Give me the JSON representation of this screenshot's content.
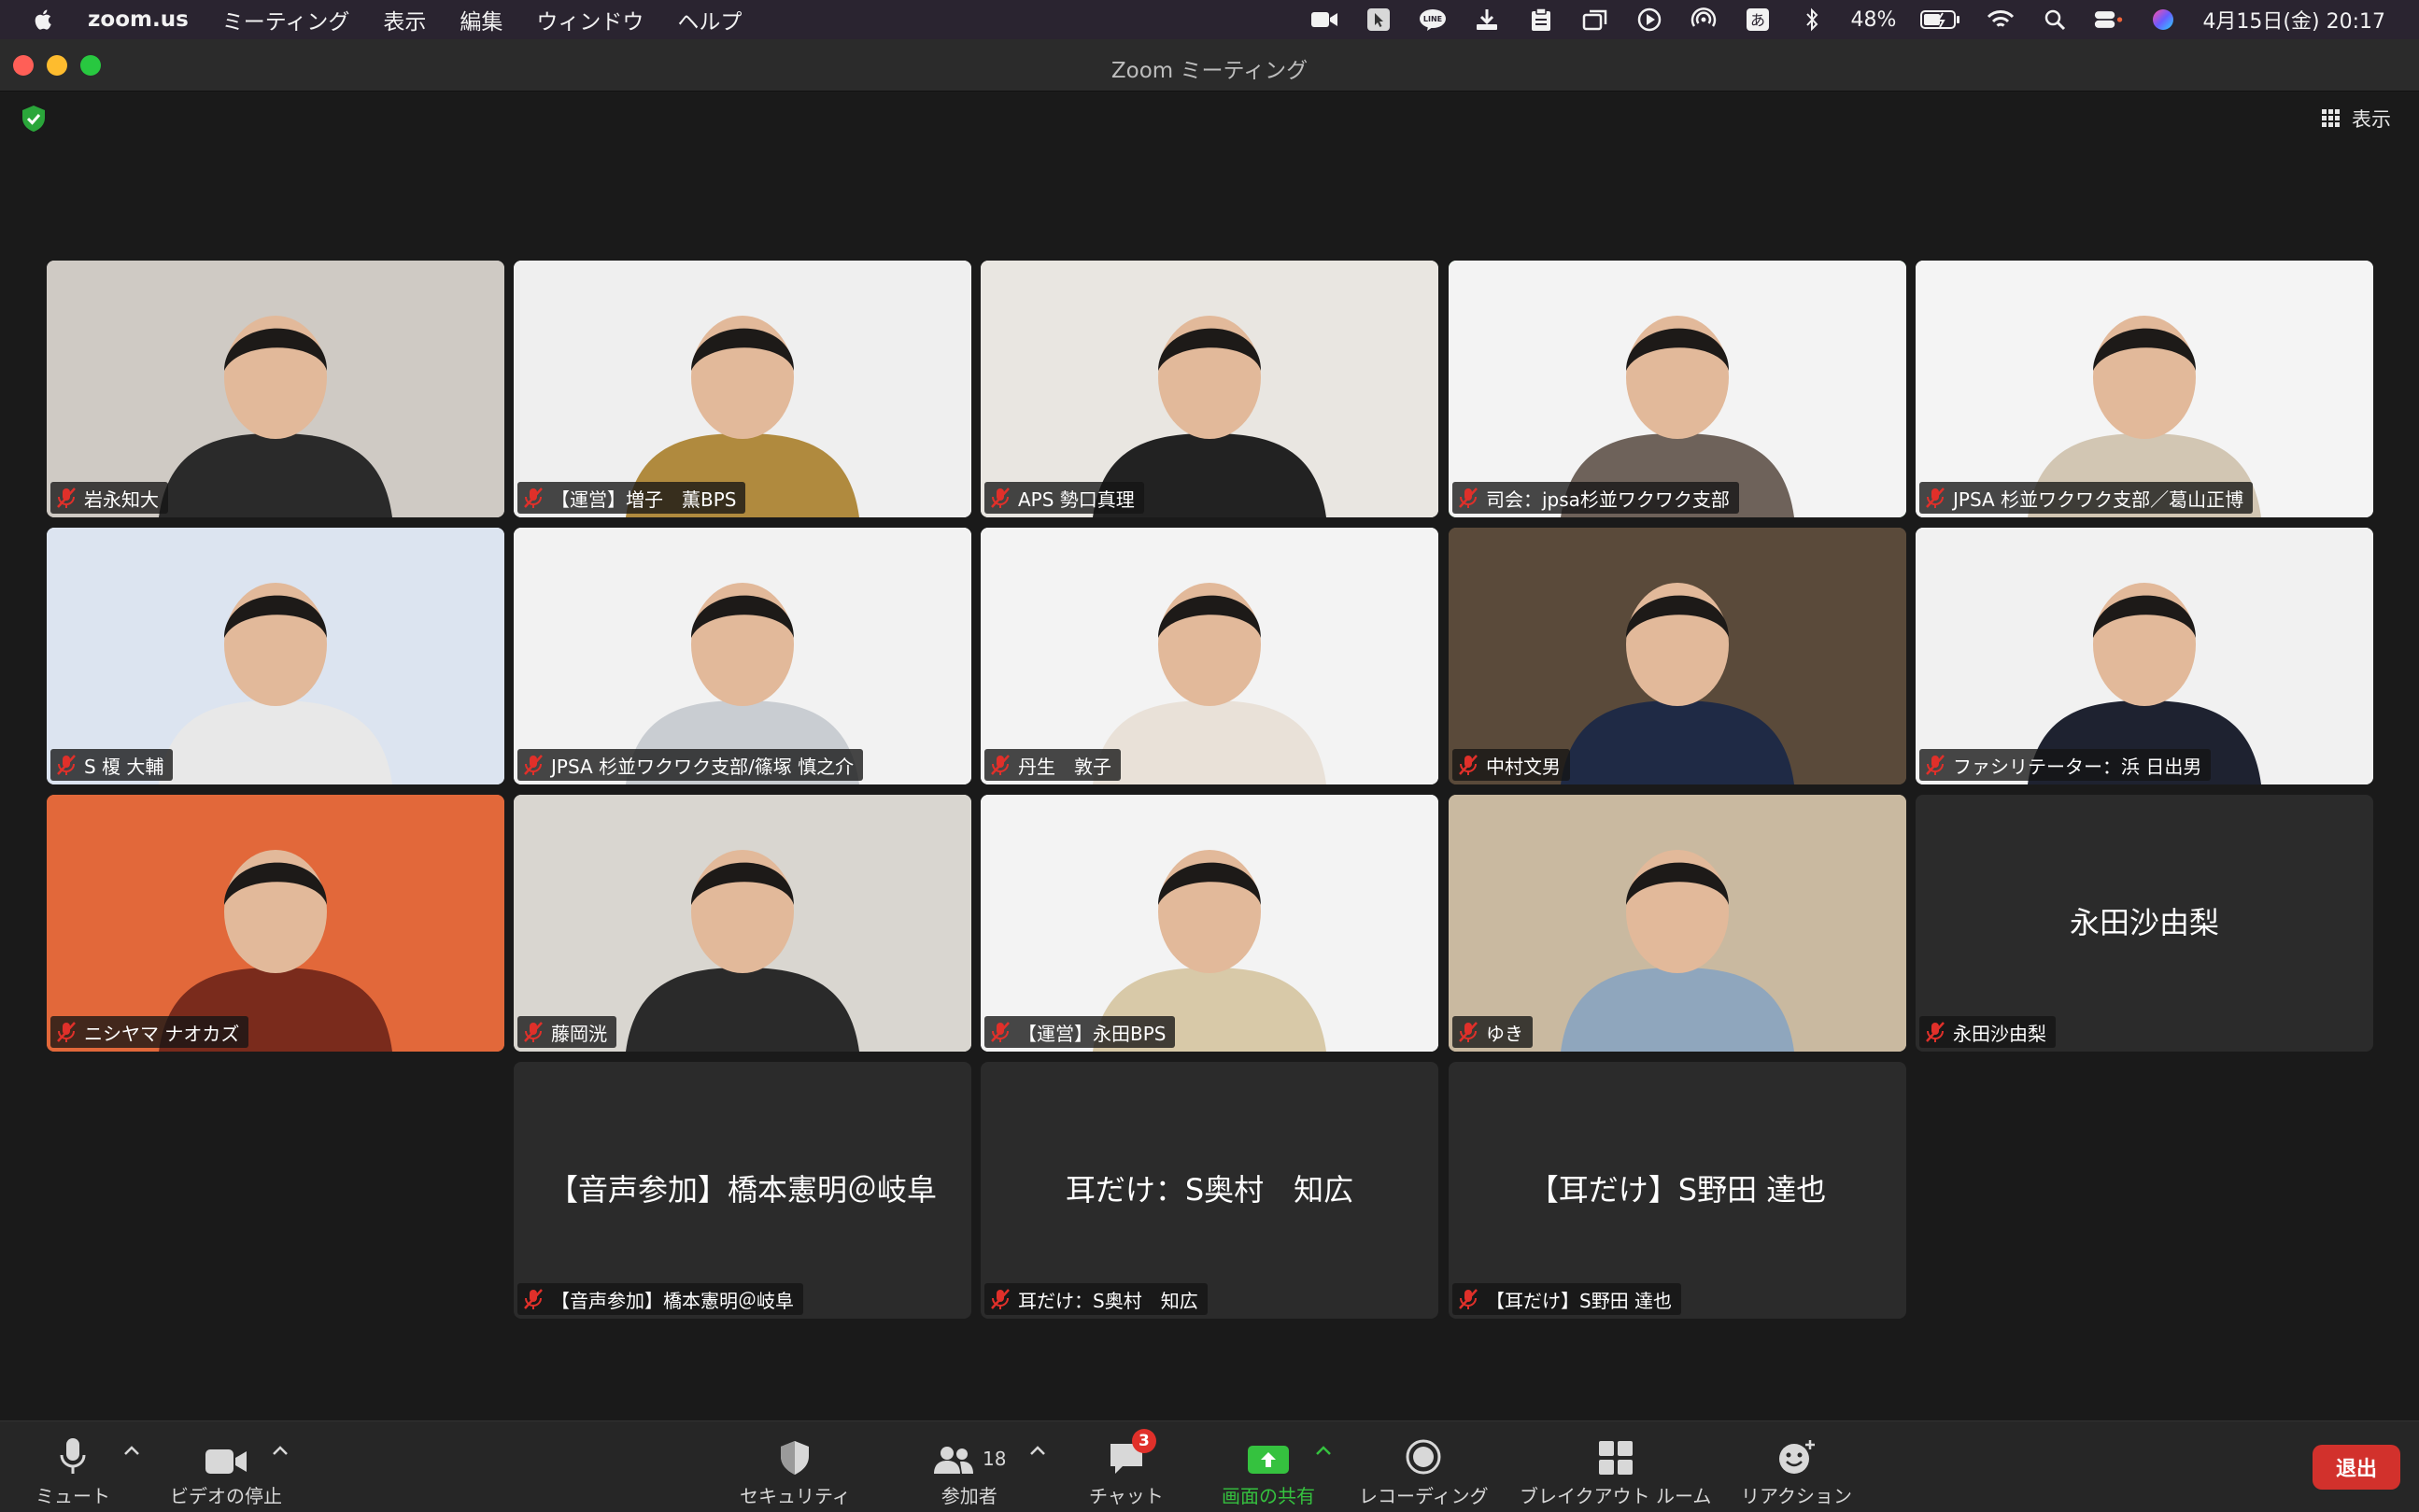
{
  "menubar": {
    "app_name": "zoom.us",
    "items": [
      "ミーティング",
      "表示",
      "編集",
      "ウィンドウ",
      "ヘルプ"
    ],
    "battery": "48%",
    "ime": "あ",
    "datetime": "4月15日(金) 20:17"
  },
  "window": {
    "title": "Zoom ミーティング"
  },
  "meeting": {
    "view_label": "表示"
  },
  "participants": [
    {
      "name": "岩永知大",
      "video": true,
      "bg": "#cfcac4",
      "shirt": "#2a2a2a"
    },
    {
      "name": "【運営】増子　薫BPS",
      "video": true,
      "bg": "#efefef",
      "shirt": "#b08a3e"
    },
    {
      "name": "APS 勢口真理",
      "video": true,
      "bg": "#e9e6e1",
      "shirt": "#222222"
    },
    {
      "name": "司会：jpsa杉並ワクワク支部",
      "video": true,
      "bg": "#f3f3f3",
      "shirt": "#6e625a",
      "active": true
    },
    {
      "name": "JPSA 杉並ワクワク支部／葛山正博",
      "video": true,
      "bg": "#f4f4f4",
      "shirt": "#d2c6b3"
    },
    {
      "name": "S 榎 大輔",
      "video": true,
      "bg": "#dce4f0",
      "shirt": "#e8e8e8"
    },
    {
      "name": "JPSA 杉並ワクワク支部/篠塚 慎之介",
      "video": true,
      "bg": "#f2f2f2",
      "shirt": "#c9cdd2"
    },
    {
      "name": "丹生　敦子",
      "video": true,
      "bg": "#f3f3f3",
      "shirt": "#e9e1d8"
    },
    {
      "name": "中村文男",
      "video": true,
      "bg": "#5a4a3a",
      "shirt": "#1f2a45"
    },
    {
      "name": "ファシリテーター：浜 日出男",
      "video": true,
      "bg": "#f1f1f1",
      "shirt": "#1e2230"
    },
    {
      "name": "ニシヤマ ナオカズ",
      "video": true,
      "bg": "#e2683a",
      "shirt": "#7a2b1c"
    },
    {
      "name": "藤岡洸",
      "video": true,
      "bg": "#d9d6d0",
      "shirt": "#2a2a2a"
    },
    {
      "name": "【運営】永田BPS",
      "video": true,
      "bg": "#f3f3f3",
      "shirt": "#d8c9a8"
    },
    {
      "name": "ゆき",
      "video": true,
      "bg": "#c9b9a0",
      "shirt": "#8fa6bd"
    },
    {
      "name": "永田沙由梨",
      "video": false
    },
    {
      "name": "【音声参加】橋本憲明＠岐阜",
      "video": false
    },
    {
      "name": "耳だけ：S奥村　知広",
      "video": false
    },
    {
      "name": "【耳だけ】S野田 達也",
      "video": false
    }
  ],
  "toolbar": {
    "mute": "ミュート",
    "stop_video": "ビデオの停止",
    "security": "セキュリティ",
    "participants": "参加者",
    "participants_count": "18",
    "chat": "チャット",
    "chat_badge": "3",
    "share": "画面の共有",
    "record": "レコーディング",
    "breakout": "ブレイクアウト ルーム",
    "reactions": "リアクション",
    "leave": "退出"
  }
}
